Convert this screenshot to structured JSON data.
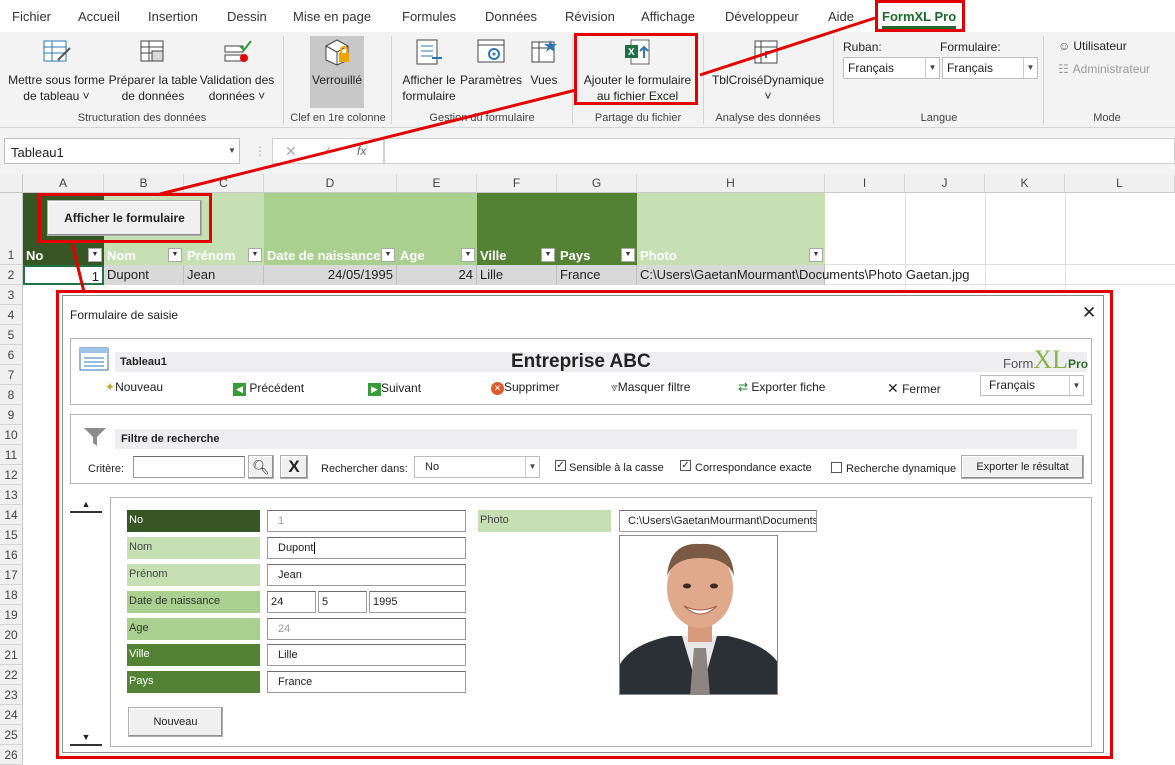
{
  "menu": [
    "Fichier",
    "Accueil",
    "Insertion",
    "Dessin",
    "Mise en page",
    "Formules",
    "Données",
    "Révision",
    "Affichage",
    "Développeur",
    "Aide",
    "FormXL Pro"
  ],
  "ribbon": {
    "structuration": {
      "btn1": [
        "Mettre sous forme",
        "de tableau ˅"
      ],
      "btn2": [
        "Préparer la table",
        "de données"
      ],
      "btn3": [
        "Validation des",
        "données ˅"
      ],
      "group": "Structuration des données"
    },
    "clef": {
      "btn": "Verrouillé",
      "group": "Clef en 1re colonne"
    },
    "gestion": {
      "btn1": [
        "Afficher le",
        "formulaire"
      ],
      "btn2": "Paramètres",
      "btn3": "Vues",
      "group": "Gestion du formulaire"
    },
    "partage": {
      "btn": [
        "Ajouter le formulaire",
        "au fichier Excel"
      ],
      "group": "Partage du fichier"
    },
    "analyse": {
      "btn": "TblCroiséDynamique",
      "group": "Analyse des données"
    },
    "langue": {
      "ruban_label": "Ruban:",
      "ruban_value": "Français",
      "formulaire_label": "Formulaire:",
      "formulaire_value": "Français",
      "group": "Langue"
    },
    "mode": {
      "user": "Utilisateur",
      "admin": "Administrateur",
      "group": "Mode"
    }
  },
  "formula_bar": {
    "name_box": "Tableau1",
    "fx": "fx"
  },
  "columns": [
    "A",
    "B",
    "C",
    "D",
    "E",
    "F",
    "G",
    "H",
    "I",
    "J",
    "K",
    "L"
  ],
  "rows": [
    "1",
    "2",
    "3",
    "4",
    "5",
    "6",
    "7",
    "8",
    "9",
    "10",
    "11",
    "12",
    "13",
    "14",
    "15",
    "16",
    "17",
    "18",
    "19",
    "20",
    "21",
    "22",
    "23",
    "24",
    "25",
    "26"
  ],
  "sheet_button": "Afficher le formulaire",
  "table": {
    "headers": [
      "No",
      "Nom",
      "Prénom",
      "Date de naissance",
      "Age",
      "Ville",
      "Pays",
      "Photo"
    ],
    "row": [
      "1",
      "Dupont",
      "Jean",
      "24/05/1995",
      "24",
      "Lille",
      "France",
      "C:\\Users\\GaetanMourmant\\Documents\\Photo Gaetan.jpg"
    ]
  },
  "dialog": {
    "title": "Formulaire de saisie",
    "table_name": "Tableau1",
    "company": "Entreprise ABC",
    "logo": {
      "form": "Form",
      "xl": "XL",
      "pro": "Pro"
    },
    "toolbar": [
      "Nouveau",
      "Précédent",
      "Suivant",
      "Supprimer",
      "Masquer filtre",
      "Exporter fiche",
      "Fermer"
    ],
    "language": "Français",
    "filter": {
      "title": "Filtre de recherche",
      "critere": "Critère:",
      "critere_value": "",
      "clear": "X",
      "rechercher_dans": "Rechercher dans:",
      "rechercher_value": "No",
      "sensible": "Sensible à la casse",
      "exacte": "Correspondance exacte",
      "dynamique": "Recherche dynamique",
      "export": "Exporter le résultat"
    },
    "fields": {
      "no": {
        "label": "No",
        "value": "1"
      },
      "nom": {
        "label": "Nom",
        "value": "Dupont"
      },
      "prenom": {
        "label": "Prénom",
        "value": "Jean"
      },
      "date": {
        "label": "Date de naissance",
        "day": "24",
        "month": "5",
        "year": "1995"
      },
      "age": {
        "label": "Age",
        "value": "24"
      },
      "ville": {
        "label": "Ville",
        "value": "Lille"
      },
      "pays": {
        "label": "Pays",
        "value": "France"
      },
      "photo": {
        "label": "Photo",
        "value": "C:\\Users\\GaetanMourmant\\Documents"
      }
    },
    "nouveau_button": "Nouveau"
  },
  "colors": {
    "dark_green": "#375623",
    "mid_green": "#548235",
    "light_green": "#a9d08e",
    "pale_green": "#c6e0b4",
    "highlight": "#e30000"
  }
}
